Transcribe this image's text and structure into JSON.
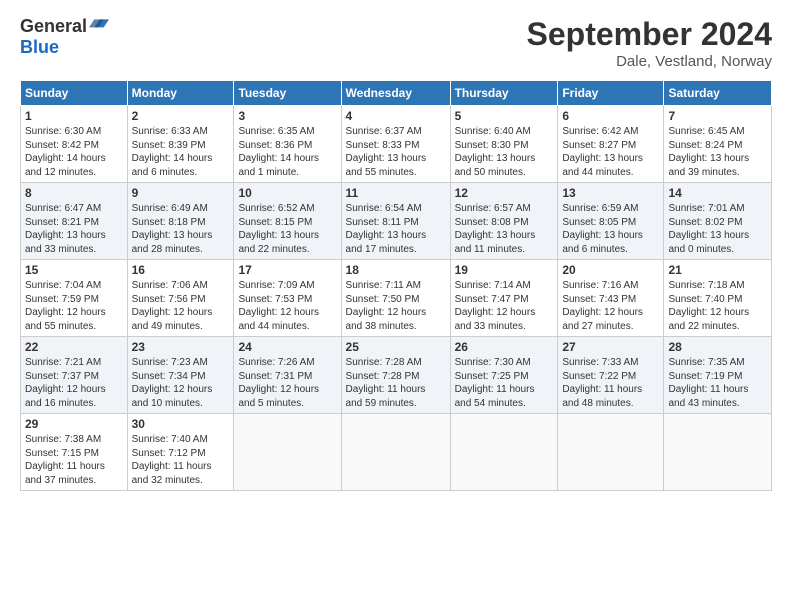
{
  "header": {
    "logo_general": "General",
    "logo_blue": "Blue",
    "title": "September 2024",
    "location": "Dale, Vestland, Norway"
  },
  "days_of_week": [
    "Sunday",
    "Monday",
    "Tuesday",
    "Wednesday",
    "Thursday",
    "Friday",
    "Saturday"
  ],
  "weeks": [
    [
      {
        "day": "1",
        "info": "Sunrise: 6:30 AM\nSunset: 8:42 PM\nDaylight: 14 hours\nand 12 minutes."
      },
      {
        "day": "2",
        "info": "Sunrise: 6:33 AM\nSunset: 8:39 PM\nDaylight: 14 hours\nand 6 minutes."
      },
      {
        "day": "3",
        "info": "Sunrise: 6:35 AM\nSunset: 8:36 PM\nDaylight: 14 hours\nand 1 minute."
      },
      {
        "day": "4",
        "info": "Sunrise: 6:37 AM\nSunset: 8:33 PM\nDaylight: 13 hours\nand 55 minutes."
      },
      {
        "day": "5",
        "info": "Sunrise: 6:40 AM\nSunset: 8:30 PM\nDaylight: 13 hours\nand 50 minutes."
      },
      {
        "day": "6",
        "info": "Sunrise: 6:42 AM\nSunset: 8:27 PM\nDaylight: 13 hours\nand 44 minutes."
      },
      {
        "day": "7",
        "info": "Sunrise: 6:45 AM\nSunset: 8:24 PM\nDaylight: 13 hours\nand 39 minutes."
      }
    ],
    [
      {
        "day": "8",
        "info": "Sunrise: 6:47 AM\nSunset: 8:21 PM\nDaylight: 13 hours\nand 33 minutes."
      },
      {
        "day": "9",
        "info": "Sunrise: 6:49 AM\nSunset: 8:18 PM\nDaylight: 13 hours\nand 28 minutes."
      },
      {
        "day": "10",
        "info": "Sunrise: 6:52 AM\nSunset: 8:15 PM\nDaylight: 13 hours\nand 22 minutes."
      },
      {
        "day": "11",
        "info": "Sunrise: 6:54 AM\nSunset: 8:11 PM\nDaylight: 13 hours\nand 17 minutes."
      },
      {
        "day": "12",
        "info": "Sunrise: 6:57 AM\nSunset: 8:08 PM\nDaylight: 13 hours\nand 11 minutes."
      },
      {
        "day": "13",
        "info": "Sunrise: 6:59 AM\nSunset: 8:05 PM\nDaylight: 13 hours\nand 6 minutes."
      },
      {
        "day": "14",
        "info": "Sunrise: 7:01 AM\nSunset: 8:02 PM\nDaylight: 13 hours\nand 0 minutes."
      }
    ],
    [
      {
        "day": "15",
        "info": "Sunrise: 7:04 AM\nSunset: 7:59 PM\nDaylight: 12 hours\nand 55 minutes."
      },
      {
        "day": "16",
        "info": "Sunrise: 7:06 AM\nSunset: 7:56 PM\nDaylight: 12 hours\nand 49 minutes."
      },
      {
        "day": "17",
        "info": "Sunrise: 7:09 AM\nSunset: 7:53 PM\nDaylight: 12 hours\nand 44 minutes."
      },
      {
        "day": "18",
        "info": "Sunrise: 7:11 AM\nSunset: 7:50 PM\nDaylight: 12 hours\nand 38 minutes."
      },
      {
        "day": "19",
        "info": "Sunrise: 7:14 AM\nSunset: 7:47 PM\nDaylight: 12 hours\nand 33 minutes."
      },
      {
        "day": "20",
        "info": "Sunrise: 7:16 AM\nSunset: 7:43 PM\nDaylight: 12 hours\nand 27 minutes."
      },
      {
        "day": "21",
        "info": "Sunrise: 7:18 AM\nSunset: 7:40 PM\nDaylight: 12 hours\nand 22 minutes."
      }
    ],
    [
      {
        "day": "22",
        "info": "Sunrise: 7:21 AM\nSunset: 7:37 PM\nDaylight: 12 hours\nand 16 minutes."
      },
      {
        "day": "23",
        "info": "Sunrise: 7:23 AM\nSunset: 7:34 PM\nDaylight: 12 hours\nand 10 minutes."
      },
      {
        "day": "24",
        "info": "Sunrise: 7:26 AM\nSunset: 7:31 PM\nDaylight: 12 hours\nand 5 minutes."
      },
      {
        "day": "25",
        "info": "Sunrise: 7:28 AM\nSunset: 7:28 PM\nDaylight: 11 hours\nand 59 minutes."
      },
      {
        "day": "26",
        "info": "Sunrise: 7:30 AM\nSunset: 7:25 PM\nDaylight: 11 hours\nand 54 minutes."
      },
      {
        "day": "27",
        "info": "Sunrise: 7:33 AM\nSunset: 7:22 PM\nDaylight: 11 hours\nand 48 minutes."
      },
      {
        "day": "28",
        "info": "Sunrise: 7:35 AM\nSunset: 7:19 PM\nDaylight: 11 hours\nand 43 minutes."
      }
    ],
    [
      {
        "day": "29",
        "info": "Sunrise: 7:38 AM\nSunset: 7:15 PM\nDaylight: 11 hours\nand 37 minutes."
      },
      {
        "day": "30",
        "info": "Sunrise: 7:40 AM\nSunset: 7:12 PM\nDaylight: 11 hours\nand 32 minutes."
      },
      {
        "day": "",
        "info": ""
      },
      {
        "day": "",
        "info": ""
      },
      {
        "day": "",
        "info": ""
      },
      {
        "day": "",
        "info": ""
      },
      {
        "day": "",
        "info": ""
      }
    ]
  ]
}
